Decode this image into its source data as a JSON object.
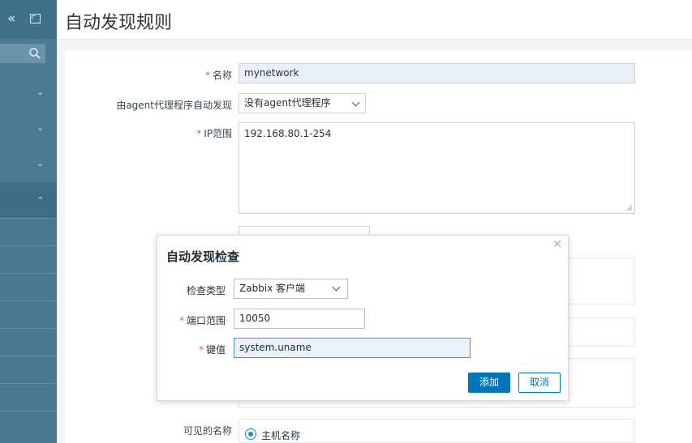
{
  "page": {
    "title": "自动发现规则"
  },
  "sidebar": {
    "collapse_icon": "chevron-double-left-icon",
    "kiosk_icon": "kiosk-mode-icon",
    "search_icon": "search-icon",
    "menus": [
      {
        "icon": "chevron-down-icon",
        "expanded": false
      },
      {
        "icon": "chevron-down-icon",
        "expanded": false
      },
      {
        "icon": "chevron-down-icon",
        "expanded": false
      },
      {
        "icon": "chevron-up-icon",
        "expanded": true
      }
    ]
  },
  "form": {
    "required_mark": "*",
    "name_label": "名称",
    "name_value": "mynetwork",
    "proxy_label": "由agent代理程序自动发现",
    "proxy_value": "没有agent代理程序",
    "ip_label": "IP范围",
    "ip_value": "192.168.80.1-254",
    "visible_name_label": "可见的名称",
    "visible_name_option": "主机名称"
  },
  "dialog": {
    "title": "自动发现检查",
    "close_icon": "close-icon",
    "required_mark": "*",
    "check_type_label": "检查类型",
    "check_type_value": "Zabbix 客户端",
    "port_label": "端口范围",
    "port_value": "10050",
    "key_label": "键值",
    "key_value": "system.uname",
    "add_label": "添加",
    "cancel_label": "取消"
  },
  "colors": {
    "sidebar": "#4c7a93",
    "primary_button": "#0275b8",
    "required": "#e45959"
  }
}
